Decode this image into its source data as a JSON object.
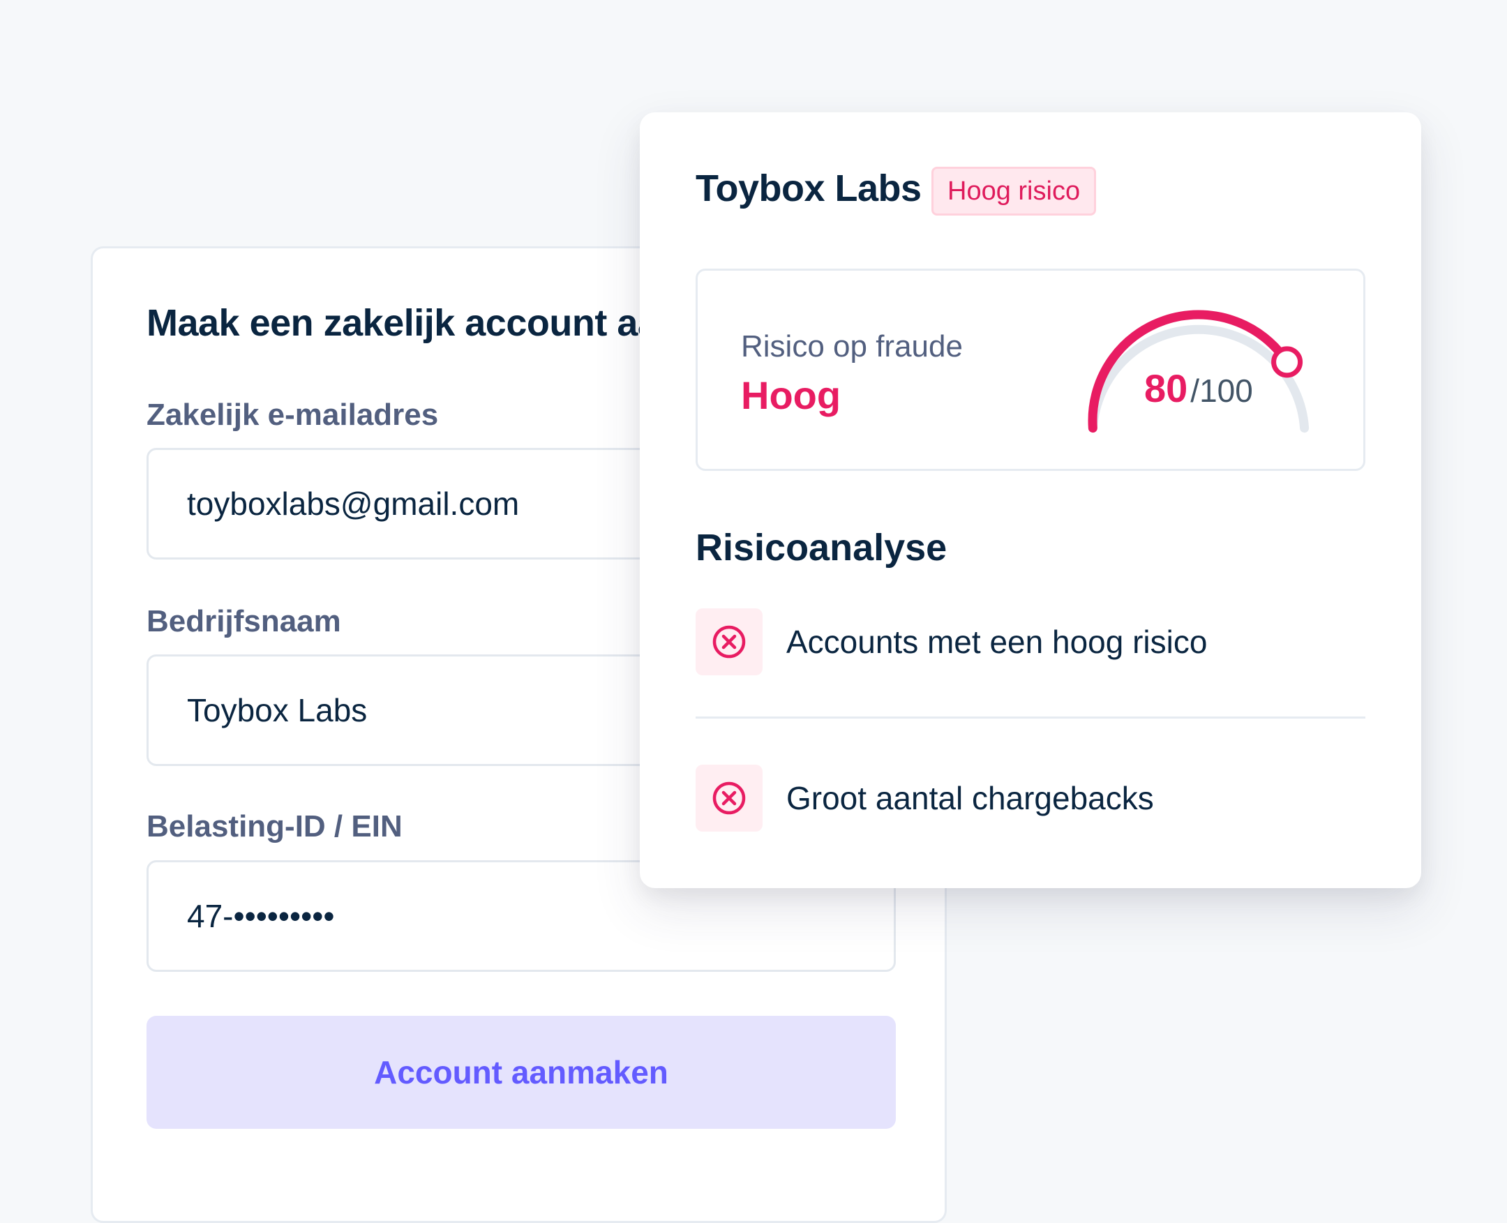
{
  "signup_form": {
    "title": "Maak een zakelijk account aan",
    "fields": [
      {
        "label": "Zakelijk e-mailadres",
        "value": "toyboxlabs@gmail.com"
      },
      {
        "label": "Bedrijfsnaam",
        "value": "Toybox Labs"
      },
      {
        "label": "Belasting-ID / EIN",
        "value": "47-•••••••••"
      }
    ],
    "submit_label": "Account aanmaken"
  },
  "risk_card": {
    "company_name": "Toybox Labs",
    "risk_badge": "Hoog risico",
    "fraud_risk": {
      "label": "Risico op fraude",
      "level": "Hoog",
      "score": "80",
      "max": "/100",
      "score_fraction": 0.8
    },
    "analysis": {
      "title": "Risicoanalyse",
      "items": [
        {
          "text": "Accounts met een hoog risico",
          "icon": "x-circle-icon"
        },
        {
          "text": "Groot aantal chargebacks",
          "icon": "x-circle-icon"
        }
      ]
    }
  },
  "colors": {
    "background": "#f6f8fa",
    "danger": "#e81c62",
    "danger_bg": "#ffe8ee",
    "accent": "#635bff",
    "accent_bg": "#e5e3fd",
    "heading": "#0a2540",
    "muted": "#525f7f",
    "gauge_track": "#e3e8ee"
  }
}
